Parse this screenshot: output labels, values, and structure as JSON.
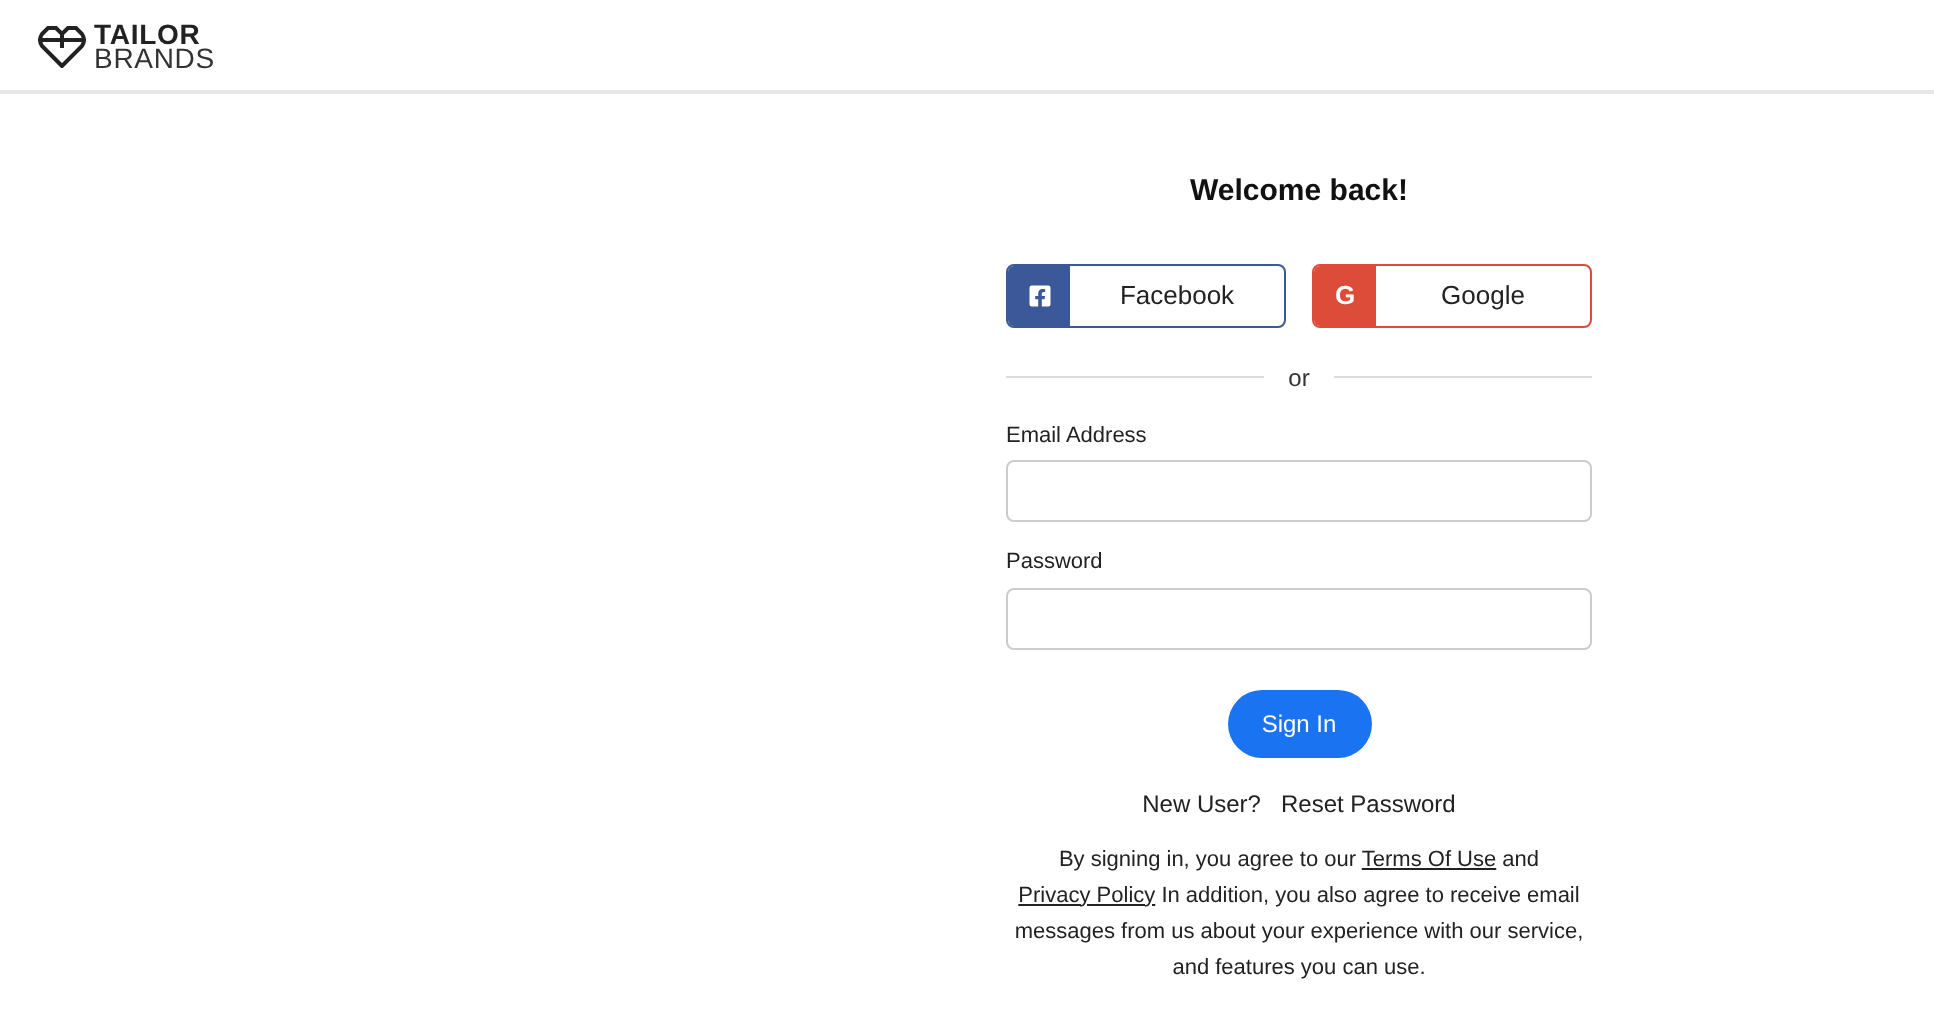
{
  "logo": {
    "line1": "TAILOR",
    "line2": "BRANDS"
  },
  "title": "Welcome back!",
  "social": [
    {
      "kind": "facebook",
      "label": "Facebook"
    },
    {
      "kind": "google",
      "label": "Google",
      "glyph": "G"
    }
  ],
  "divider": "or",
  "fields": [
    {
      "label": "Email Address"
    },
    {
      "label": "Password"
    }
  ],
  "submit": "Sign In",
  "links": [
    "New User?",
    "Reset Password"
  ],
  "legal": {
    "before": "By signing in, you agree to our ",
    "terms": "Terms Of Use",
    "middle": " and ",
    "privacy": "Privacy Policy",
    "after": " In addition, you also agree to receive email messages from us about your experience with our service, and features you can use."
  }
}
